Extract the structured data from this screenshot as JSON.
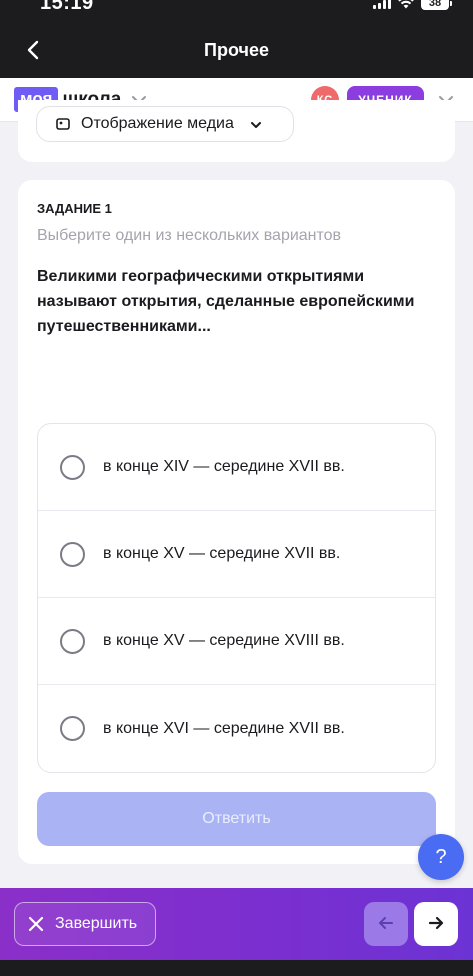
{
  "status_bar": {
    "time": "15:19",
    "battery": "38"
  },
  "nav": {
    "title": "Прочее"
  },
  "header": {
    "logo_badge": "моя",
    "logo_word": "школа",
    "avatar_initials": "КС",
    "role": "УЧЕНИК"
  },
  "media": {
    "label": "Отображение медиа"
  },
  "task": {
    "label": "ЗАДАНИЕ 1",
    "instruction": "Выберите один из нескольких вариантов",
    "question": "Великими географическими открытиями называют открытия, сделанные европейскими путешественниками...",
    "options": [
      "в конце XIV — середине XVII вв.",
      "в конце XV — середине XVII вв.",
      "в конце XV — середине XVIII вв.",
      "в конце XVI — середине XVII вв."
    ],
    "answer_label": "Ответить"
  },
  "help": {
    "label": "?"
  },
  "bottom": {
    "finish_label": "Завершить"
  },
  "colors": {
    "brand": "#6f5cf5",
    "role_badge": "#8b3ddf",
    "avatar": "#ef6a6a",
    "answer_disabled": "#aab4f5",
    "help": "#4a6cf2",
    "bottom_bar": "#7a2fd0"
  }
}
